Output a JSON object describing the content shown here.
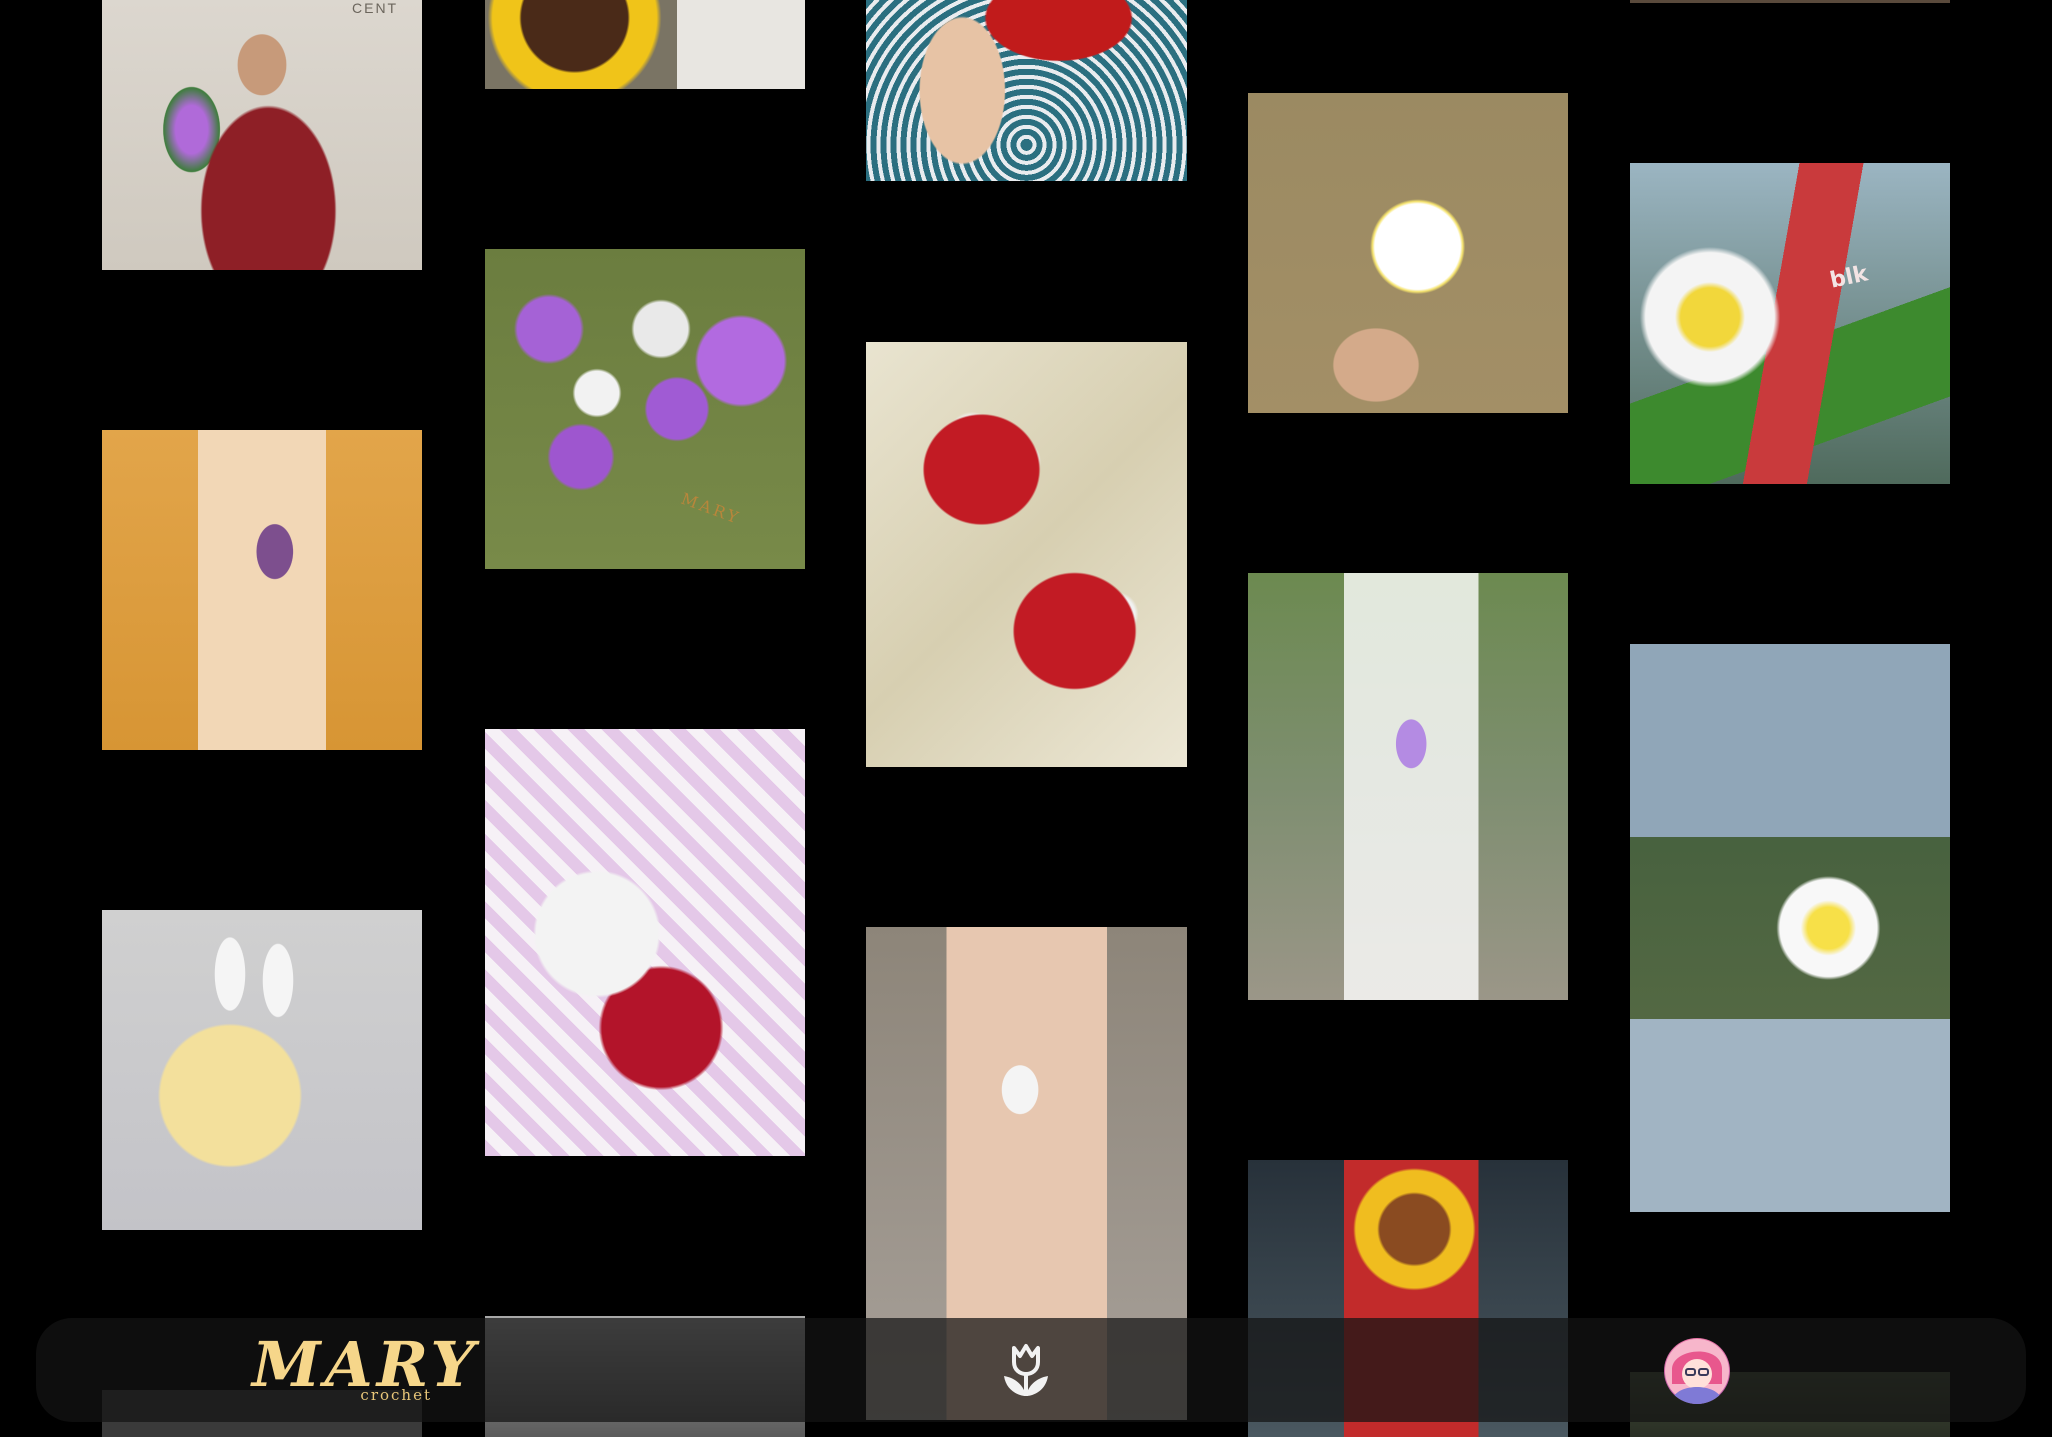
{
  "brand": {
    "name": "MARY",
    "sub": "crochet"
  },
  "gallery": {
    "photo_text": {
      "wall_sign": "CENT",
      "lipstick_label": "blk",
      "card_logo": "MARY"
    }
  },
  "icons": {
    "home": "tulip-icon",
    "profile": "avatar-icon"
  },
  "colors": {
    "background": "#000000",
    "logo_gold": "#f6d68a",
    "dock": "#141414"
  }
}
